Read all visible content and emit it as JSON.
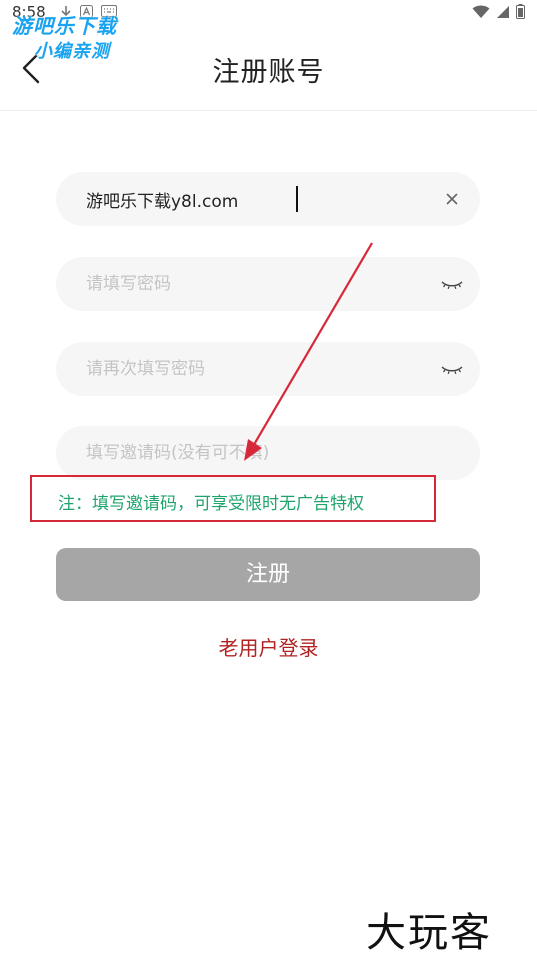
{
  "status_bar": {
    "time": "8:58",
    "notification_icons": [
      "download-icon",
      "a-icon",
      "keyboard-icon"
    ],
    "right_icons": [
      "wifi-icon",
      "signal-icon",
      "battery-icon"
    ]
  },
  "watermark": {
    "line1": "游吧乐下载",
    "line2": "小编亲测"
  },
  "header": {
    "title": "注册账号",
    "back_icon": "chevron-left-icon"
  },
  "form": {
    "account": {
      "value": "游吧乐下载y8l.com",
      "clear_icon": "close-icon"
    },
    "password": {
      "placeholder": "请填写密码",
      "icon": "eye-closed-icon"
    },
    "confirm_password": {
      "placeholder": "请再次填写密码",
      "icon": "eye-closed-icon"
    },
    "invite_code": {
      "placeholder": "填写邀请码(没有可不填)"
    }
  },
  "note": {
    "text": "注：填写邀请码，可享受限时无广告特权",
    "border_color": "#d7283a",
    "text_color": "#1fa46c"
  },
  "register_button": {
    "label": "注册",
    "color": "#a6a6a6"
  },
  "login_link": {
    "label": "老用户登录",
    "color": "#b22222"
  },
  "brand": {
    "logo_text": "大玩客"
  }
}
